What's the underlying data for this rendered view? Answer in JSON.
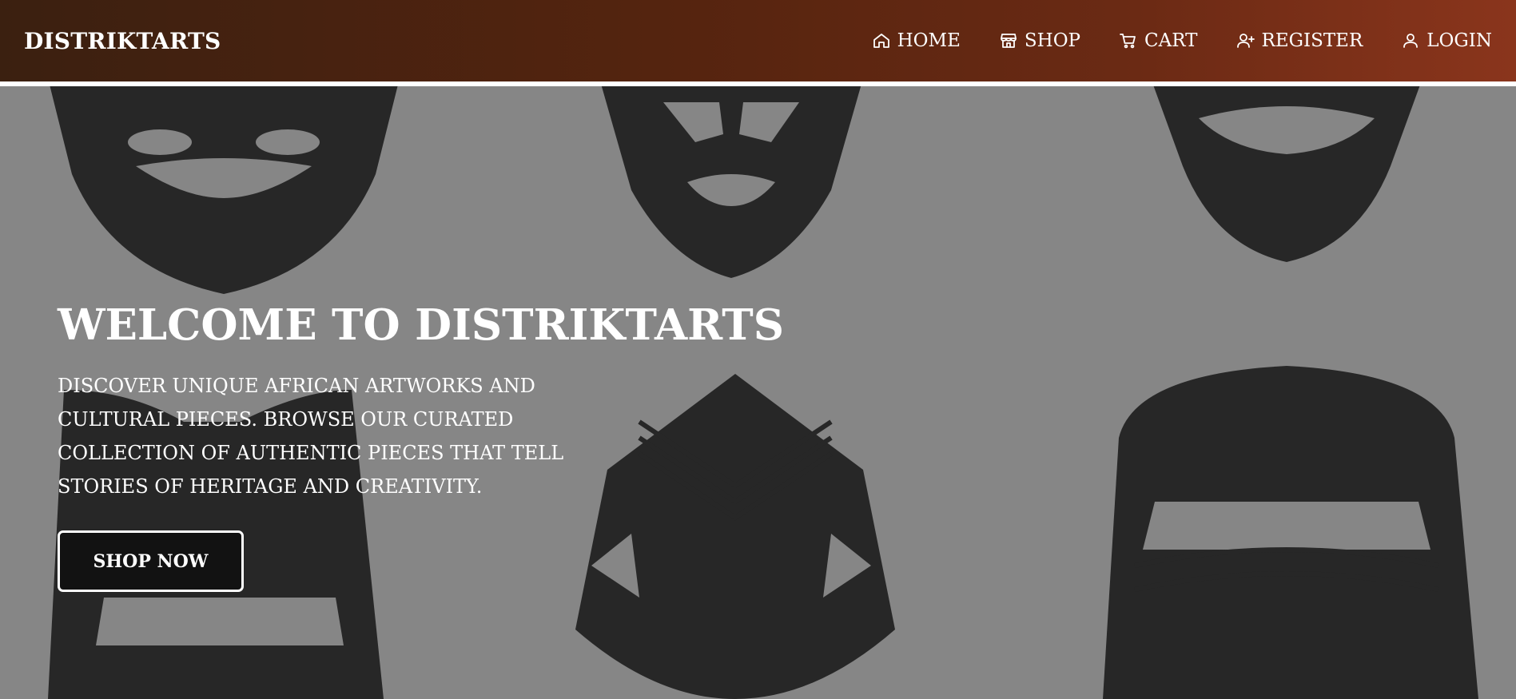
{
  "brand": "DISTRIKTARTS",
  "nav": {
    "items": [
      {
        "label": "HOME",
        "icon": "home-icon"
      },
      {
        "label": "SHOP",
        "icon": "store-icon"
      },
      {
        "label": "CART",
        "icon": "cart-icon"
      },
      {
        "label": "REGISTER",
        "icon": "user-plus-icon"
      },
      {
        "label": "LOGIN",
        "icon": "user-icon"
      }
    ]
  },
  "hero": {
    "title": "WELCOME TO DISTRIKTARTS",
    "text": "DISCOVER UNIQUE AFRICAN ARTWORKS AND CULTURAL PIECES. BROWSE OUR CURATED COLLECTION OF AUTHENTIC PIECES THAT TELL STORIES OF HERITAGE AND CREATIVITY.",
    "button": "SHOP NOW",
    "background": "african-masks-pattern"
  },
  "colors": {
    "nav_gradient_start": "#3b2010",
    "nav_gradient_end": "#8a351c",
    "overlay": "#6f6f6f",
    "button_bg": "#121212",
    "text": "#ffffff"
  }
}
